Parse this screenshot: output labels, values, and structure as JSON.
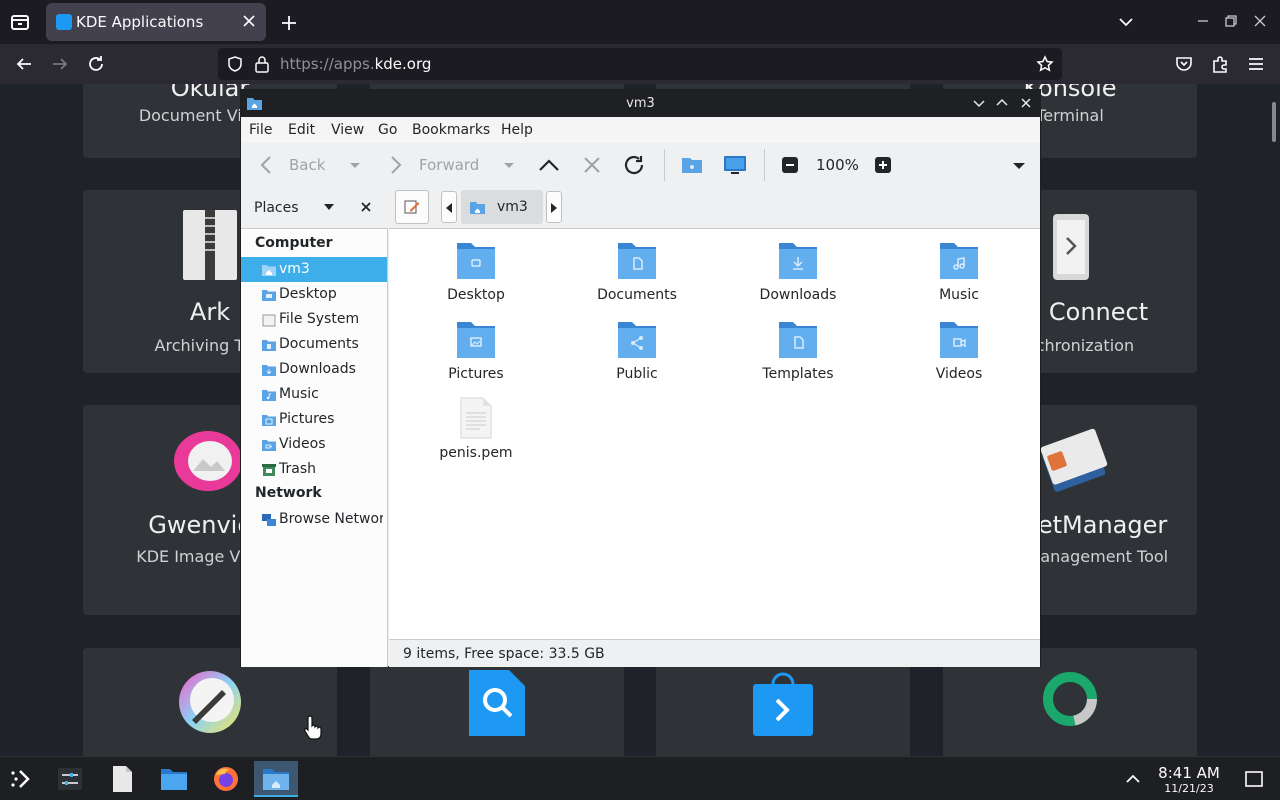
{
  "browser": {
    "tab_title": "KDE Applications",
    "url_prefix": "https://apps.",
    "url_host": "kde.org"
  },
  "page": {
    "cards": [
      {
        "title": "Okular",
        "subtitle": "Document Viewer"
      },
      {
        "title": "Konsole",
        "subtitle": "Terminal"
      },
      {
        "title": "Ark",
        "subtitle": "Archiving Tool"
      },
      {
        "title": "KDE Connect",
        "subtitle": "Synchronization"
      },
      {
        "title": "Gwenview",
        "subtitle": "KDE Image Viewer"
      },
      {
        "title": "KWalletManager",
        "subtitle": "Wallet Management Tool"
      }
    ]
  },
  "dolphin": {
    "title": "vm3",
    "menu": [
      "File",
      "Edit",
      "View",
      "Go",
      "Bookmarks",
      "Help"
    ],
    "toolbar": {
      "back": "Back",
      "forward": "Forward",
      "zoom": "100%"
    },
    "places_label": "Places",
    "places_groups": {
      "computer": "Computer",
      "network": "Network"
    },
    "places": [
      "vm3",
      "Desktop",
      "File System",
      "Documents",
      "Downloads",
      "Music",
      "Pictures",
      "Videos",
      "Trash"
    ],
    "network_places": [
      "Browse Network"
    ],
    "breadcrumb": "vm3",
    "files": [
      "Desktop",
      "Documents",
      "Downloads",
      "Music",
      "Pictures",
      "Public",
      "Templates",
      "Videos",
      "penis.pem"
    ],
    "status": "9 items, Free space: 33.5 GB"
  },
  "taskbar": {
    "time": "8:41 AM",
    "date": "11/21/23"
  },
  "colors": {
    "accent": "#3daee9",
    "folder": "#5aa4e6",
    "firefox_bg": "#1c1b22"
  }
}
